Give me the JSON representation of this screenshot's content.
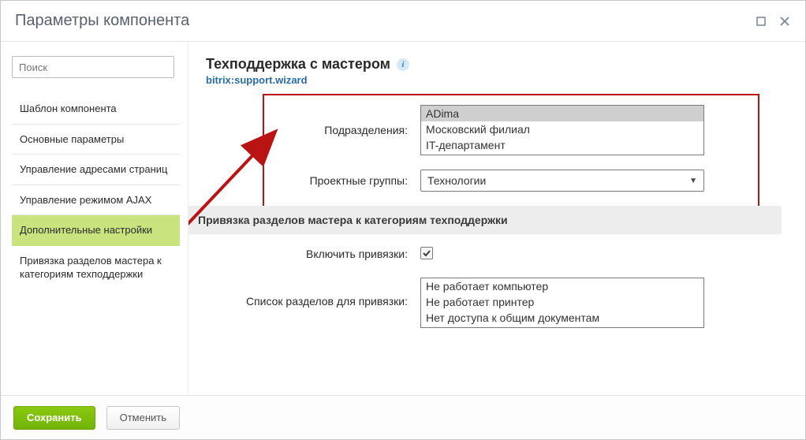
{
  "window": {
    "title": "Параметры компонента"
  },
  "sidebar": {
    "search_placeholder": "Поиск",
    "items": [
      {
        "label": "Шаблон компонента"
      },
      {
        "label": "Основные параметры"
      },
      {
        "label": "Управление адресами страниц"
      },
      {
        "label": "Управление режимом AJAX"
      },
      {
        "label": "Дополнительные настройки"
      },
      {
        "label": "Привязка разделов мастера к категориям техподдержки"
      }
    ],
    "active_index": 4
  },
  "content": {
    "title": "Техподдержка с мастером",
    "subtitle": "bitrix:support.wizard",
    "departments": {
      "label": "Подразделения:",
      "options": [
        {
          "text": "ADima",
          "selected": true
        },
        {
          "text": "Московский филиал",
          "selected": false
        },
        {
          "text": "IT-департамент",
          "selected": false
        }
      ]
    },
    "groups": {
      "label": "Проектные группы:",
      "value": "Технологии"
    },
    "section": {
      "header": "Привязка разделов мастера к категориям техподдержки",
      "enable_label": "Включить привязки:",
      "enable_checked": true
    },
    "bindings_list": {
      "label": "Список разделов для привязки:",
      "options": [
        {
          "text": "Не работает компьютер",
          "selected": false
        },
        {
          "text": "Не работает принтер",
          "selected": false
        },
        {
          "text": "Нет доступа к общим документам",
          "selected": false
        }
      ]
    }
  },
  "footer": {
    "save": "Сохранить",
    "cancel": "Отменить"
  }
}
